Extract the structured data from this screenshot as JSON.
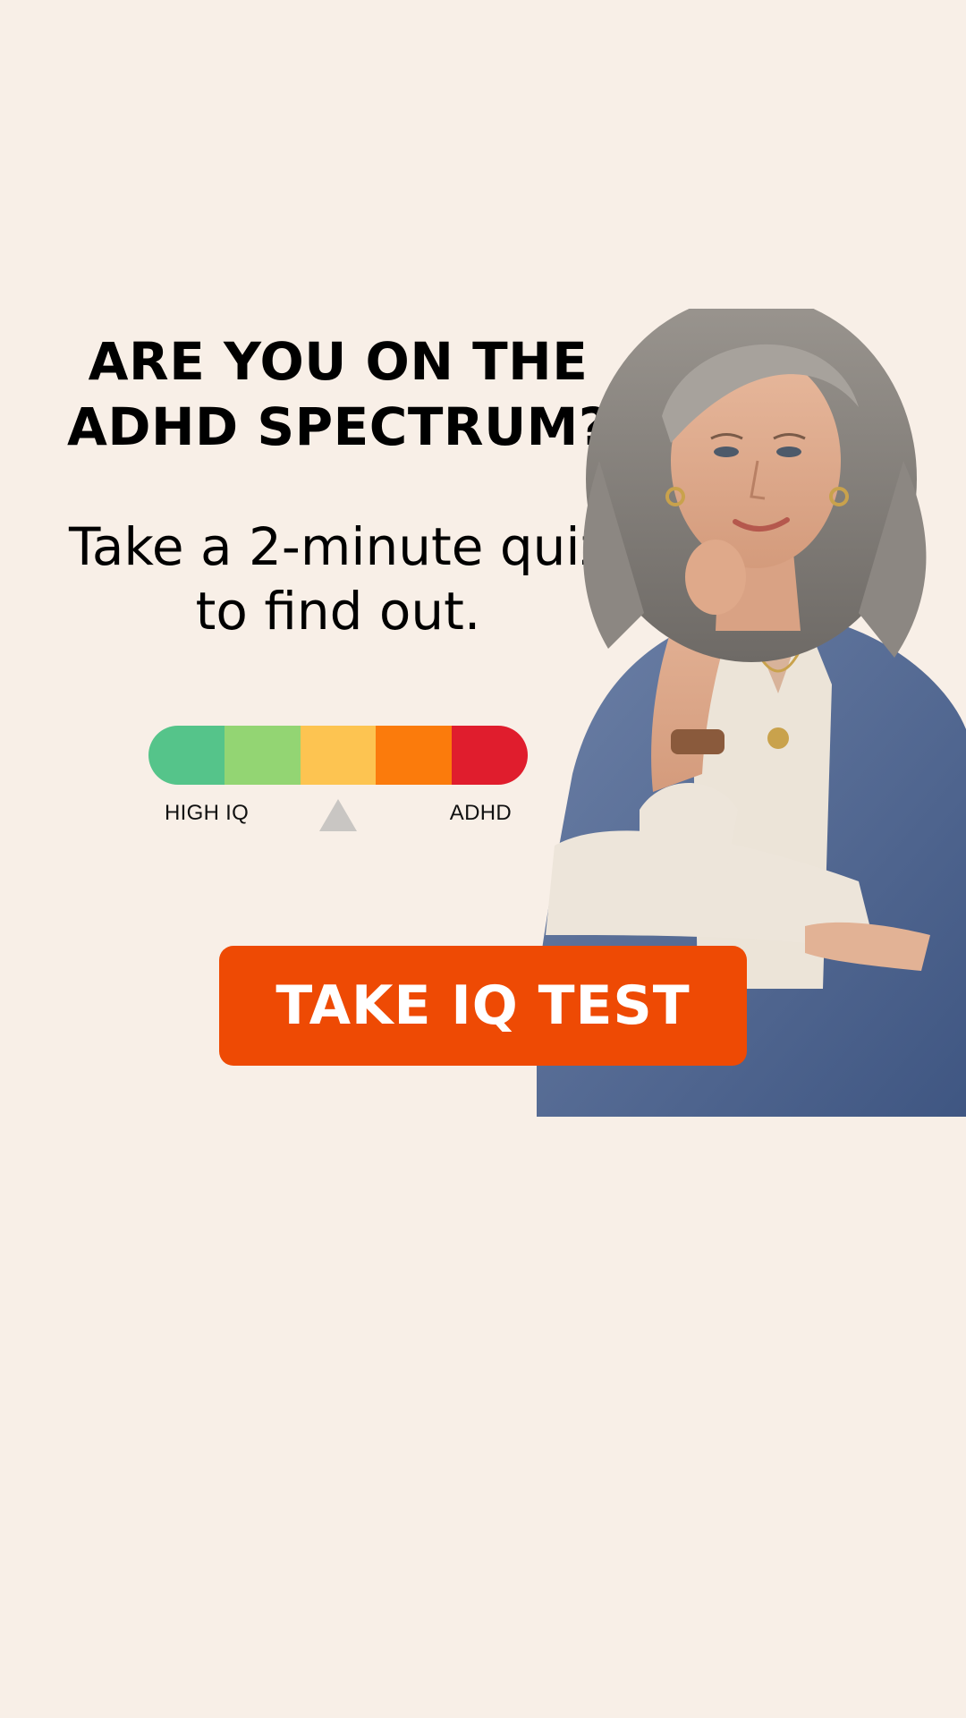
{
  "headline": {
    "line1": "ARE YOU ON THE",
    "line2": "ADHD SPECTRUM?"
  },
  "subheadline": {
    "line1": "Take a 2-minute quiz",
    "line2": "to find out."
  },
  "spectrum_meter": {
    "segment_colors": [
      "#55c48a",
      "#93d573",
      "#fdc451",
      "#fb7b0c",
      "#e01d2d"
    ],
    "left_label": "HIGH IQ",
    "right_label": "ADHD",
    "pointer_position_fraction": 0.5,
    "pointer_color": "#c9c6c3"
  },
  "cta": {
    "label": "TAKE IQ TEST",
    "color": "#ee4a04"
  },
  "background_color": "#f8efe7"
}
